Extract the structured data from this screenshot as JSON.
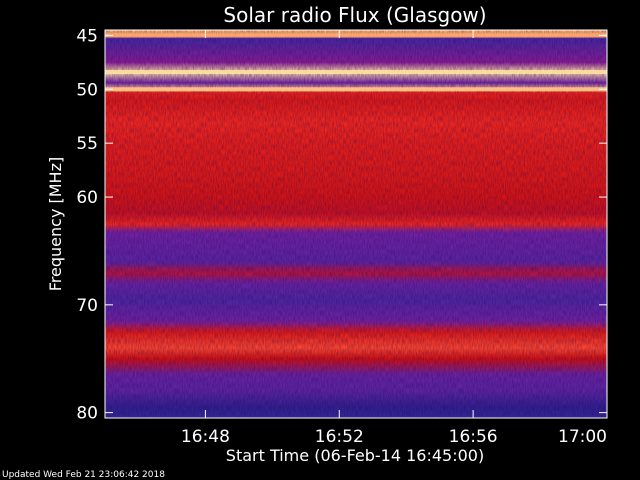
{
  "chart_data": {
    "type": "heatmap",
    "title": "Solar radio Flux (Glasgow)",
    "xlabel": "Start Time (06-Feb-14 16:45:00)",
    "ylabel": "Frequency [MHz]",
    "footer": "Updated Wed Feb 21 23:06:42 2018",
    "x_unit": "time",
    "x_range": [
      "16:45",
      "17:00"
    ],
    "x_ticks": [
      "16:48",
      "16:52",
      "16:56",
      "17:00"
    ],
    "x_tick_minutes": [
      3,
      7,
      11,
      15
    ],
    "y_range_mhz": [
      44.5,
      80.5
    ],
    "y_ticks": [
      45,
      50,
      55,
      60,
      70,
      80
    ],
    "colormap": [
      "#1a0a5a",
      "#3a2aa0",
      "#8020a0",
      "#d01010",
      "#ff3020",
      "#ffa060",
      "#ffffc0"
    ],
    "grid": false,
    "intensity_profile": [
      {
        "mhz": 45.0,
        "level": 0.85
      },
      {
        "mhz": 45.3,
        "level": 0.2
      },
      {
        "mhz": 47.5,
        "level": 0.35
      },
      {
        "mhz": 48.4,
        "level": 0.95
      },
      {
        "mhz": 49.4,
        "level": 0.3
      },
      {
        "mhz": 50.0,
        "level": 0.9
      },
      {
        "mhz": 50.3,
        "level": 0.6
      },
      {
        "mhz": 51.0,
        "level": 0.55
      },
      {
        "mhz": 53.0,
        "level": 0.62
      },
      {
        "mhz": 55.0,
        "level": 0.58
      },
      {
        "mhz": 58.0,
        "level": 0.55
      },
      {
        "mhz": 60.0,
        "level": 0.52
      },
      {
        "mhz": 61.5,
        "level": 0.48
      },
      {
        "mhz": 62.5,
        "level": 0.62
      },
      {
        "mhz": 63.3,
        "level": 0.3
      },
      {
        "mhz": 66.0,
        "level": 0.25
      },
      {
        "mhz": 67.0,
        "level": 0.45
      },
      {
        "mhz": 68.0,
        "level": 0.28
      },
      {
        "mhz": 69.5,
        "level": 0.22
      },
      {
        "mhz": 71.5,
        "level": 0.3
      },
      {
        "mhz": 72.5,
        "level": 0.55
      },
      {
        "mhz": 74.0,
        "level": 0.7
      },
      {
        "mhz": 75.0,
        "level": 0.5
      },
      {
        "mhz": 76.5,
        "level": 0.28
      },
      {
        "mhz": 78.0,
        "level": 0.25
      },
      {
        "mhz": 79.5,
        "level": 0.12
      },
      {
        "mhz": 80.5,
        "level": 0.15
      }
    ]
  }
}
